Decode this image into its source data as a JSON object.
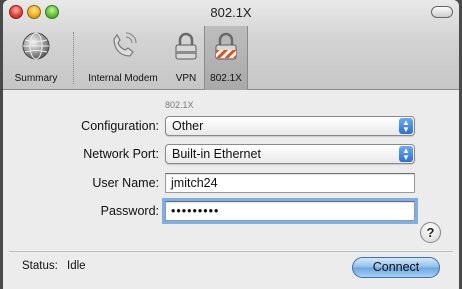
{
  "window": {
    "title": "802.1X"
  },
  "toolbar": {
    "items": [
      {
        "label": "Summary",
        "icon": "globe-icon"
      },
      {
        "label": "Internal Modem",
        "icon": "phone-icon"
      },
      {
        "label": "VPN",
        "icon": "lock-icon"
      },
      {
        "label": "802.1X",
        "icon": "lock-striped-icon",
        "selected": true
      }
    ]
  },
  "form": {
    "location": "802.1X",
    "configuration": {
      "label": "Configuration:",
      "value": "Other"
    },
    "network_port": {
      "label": "Network Port:",
      "value": "Built-in Ethernet"
    },
    "user_name": {
      "label": "User Name:",
      "value": "jmitch24"
    },
    "password": {
      "label": "Password:",
      "value": "•••••••••"
    }
  },
  "status": {
    "label": "Status:",
    "value": "Idle"
  },
  "buttons": {
    "help": "?",
    "connect": "Connect"
  },
  "colors": {
    "accent": "#2b6fd3",
    "focus_ring": "#7eaee8"
  }
}
